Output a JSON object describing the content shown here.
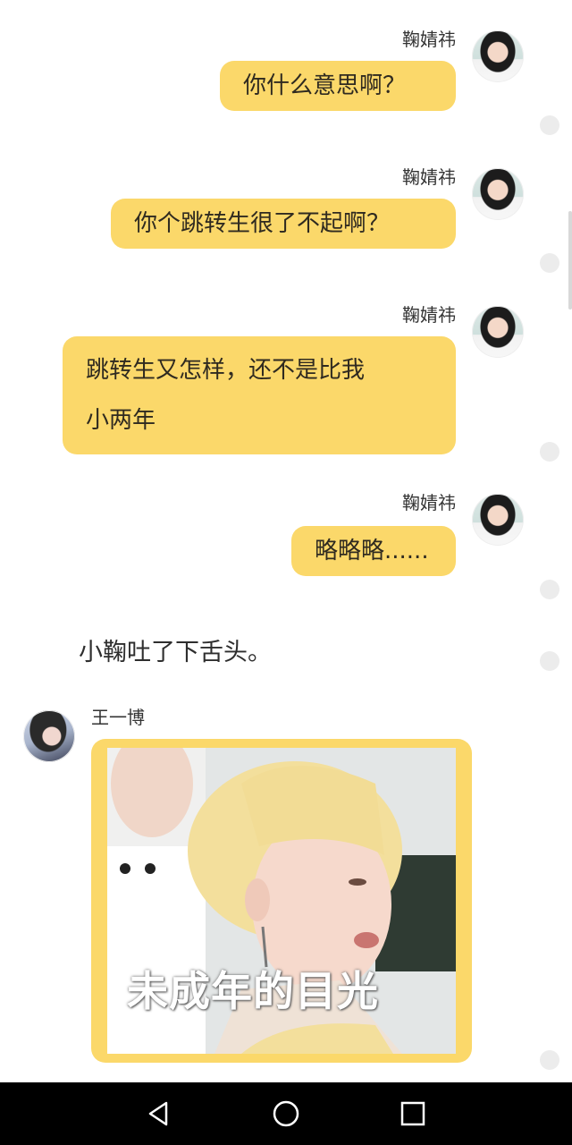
{
  "messages": [
    {
      "sender": "鞠婧祎",
      "text": "你什么意思啊？"
    },
    {
      "sender": "鞠婧祎",
      "text": "你个跳转生很了不起啊？"
    },
    {
      "sender": "鞠婧祎",
      "text_line1": "跳转生又怎样，还不是比我",
      "text_line2": "小两年"
    },
    {
      "sender": "鞠婧祎",
      "text": "略略略......"
    }
  ],
  "narration": "小鞠吐了下舌头。",
  "image_message": {
    "sender": "王一博",
    "caption": "未成年的目光"
  },
  "colors": {
    "bubble": "#fbd86a",
    "background": "#ffffff",
    "navbar": "#000000"
  },
  "navbar": {
    "back_icon": "back-triangle-icon",
    "home_icon": "home-circle-icon",
    "recents_icon": "recents-square-icon"
  }
}
